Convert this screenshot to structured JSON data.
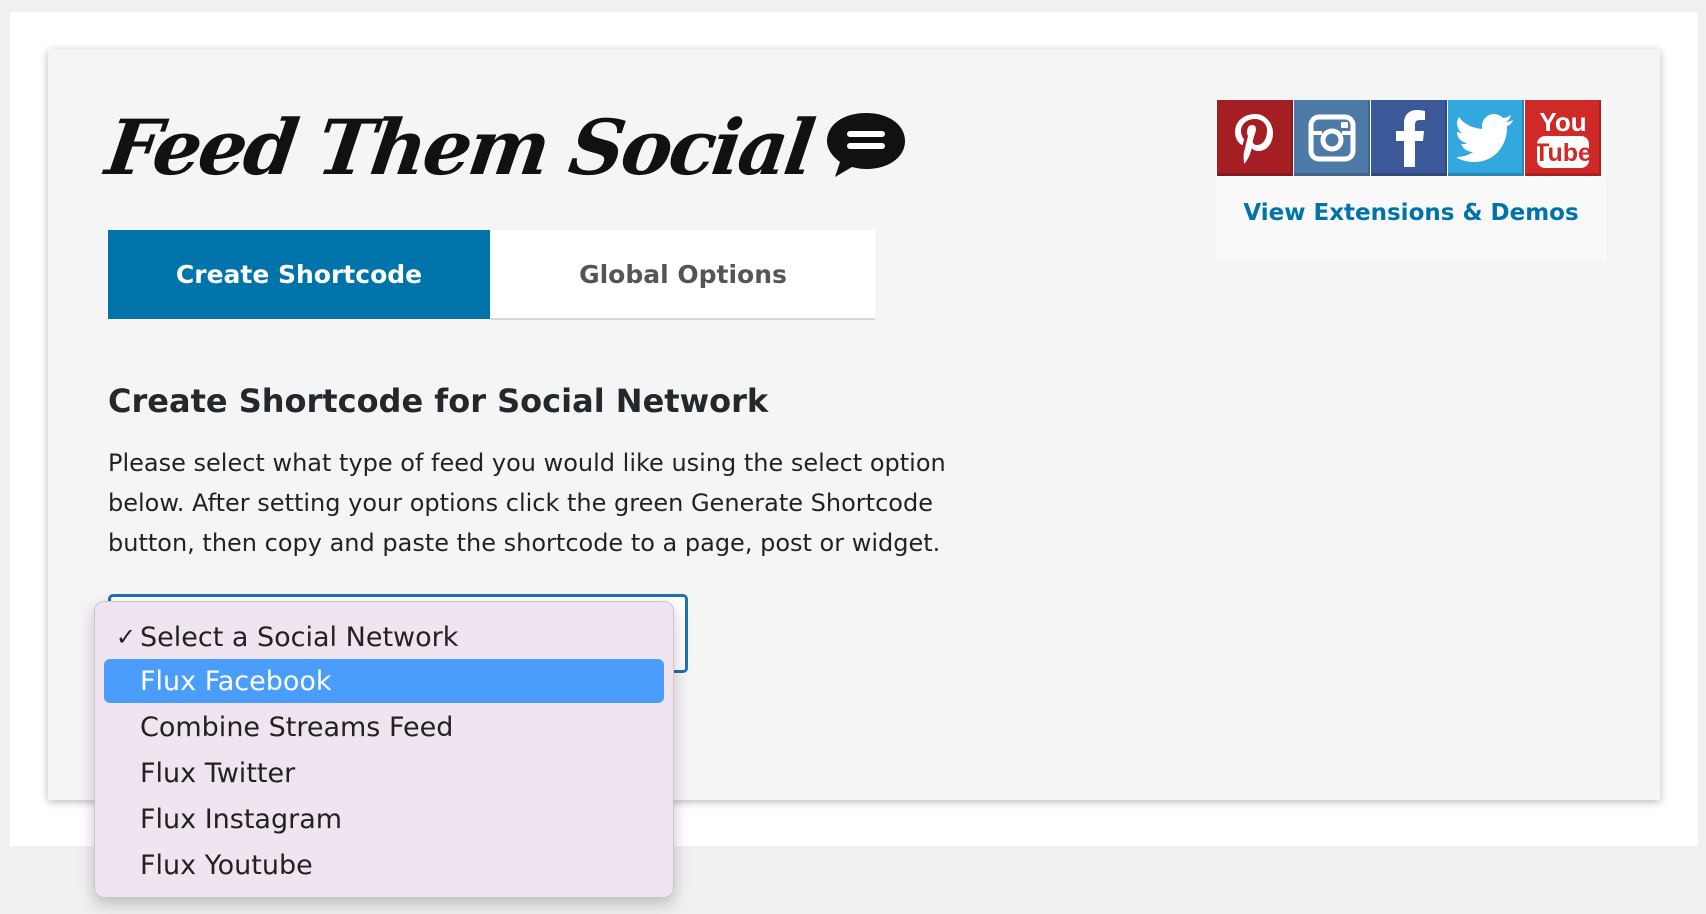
{
  "logo": {
    "text": "Feed Them Social",
    "icon": "speech-bubble-icon"
  },
  "tabs": [
    {
      "label": "Create Shortcode",
      "active": true
    },
    {
      "label": "Global Options",
      "active": false
    }
  ],
  "main": {
    "title": "Create Shortcode for Social Network",
    "description": "Please select what type of feed you would like using the select option below. After setting your options click the green Generate Shortcode button, then copy and paste the shortcode to a page, post or widget."
  },
  "select": {
    "selected": "Select a Social Network",
    "options": [
      {
        "label": "Select a Social Network",
        "checked": true,
        "highlighted": false
      },
      {
        "label": "Flux Facebook",
        "checked": false,
        "highlighted": true
      },
      {
        "label": "Combine Streams Feed",
        "checked": false,
        "highlighted": false
      },
      {
        "label": "Flux Twitter",
        "checked": false,
        "highlighted": false
      },
      {
        "label": "Flux Instagram",
        "checked": false,
        "highlighted": false
      },
      {
        "label": "Flux Youtube",
        "checked": false,
        "highlighted": false
      }
    ]
  },
  "social": {
    "icons": [
      {
        "name": "pinterest-icon",
        "color": "#a51e24"
      },
      {
        "name": "instagram-icon",
        "color": "#4d7aa6"
      },
      {
        "name": "facebook-icon",
        "color": "#3b5998"
      },
      {
        "name": "twitter-icon",
        "color": "#33a8de"
      },
      {
        "name": "youtube-icon",
        "color": "#cf2a27",
        "text_top": "You",
        "text_bottom": "Tube"
      }
    ],
    "link_label": "View Extensions & Demos"
  },
  "colors": {
    "accent": "#0073aa",
    "dropdown_highlight": "#4a9dfb",
    "dropdown_bg": "#efe4ef"
  }
}
